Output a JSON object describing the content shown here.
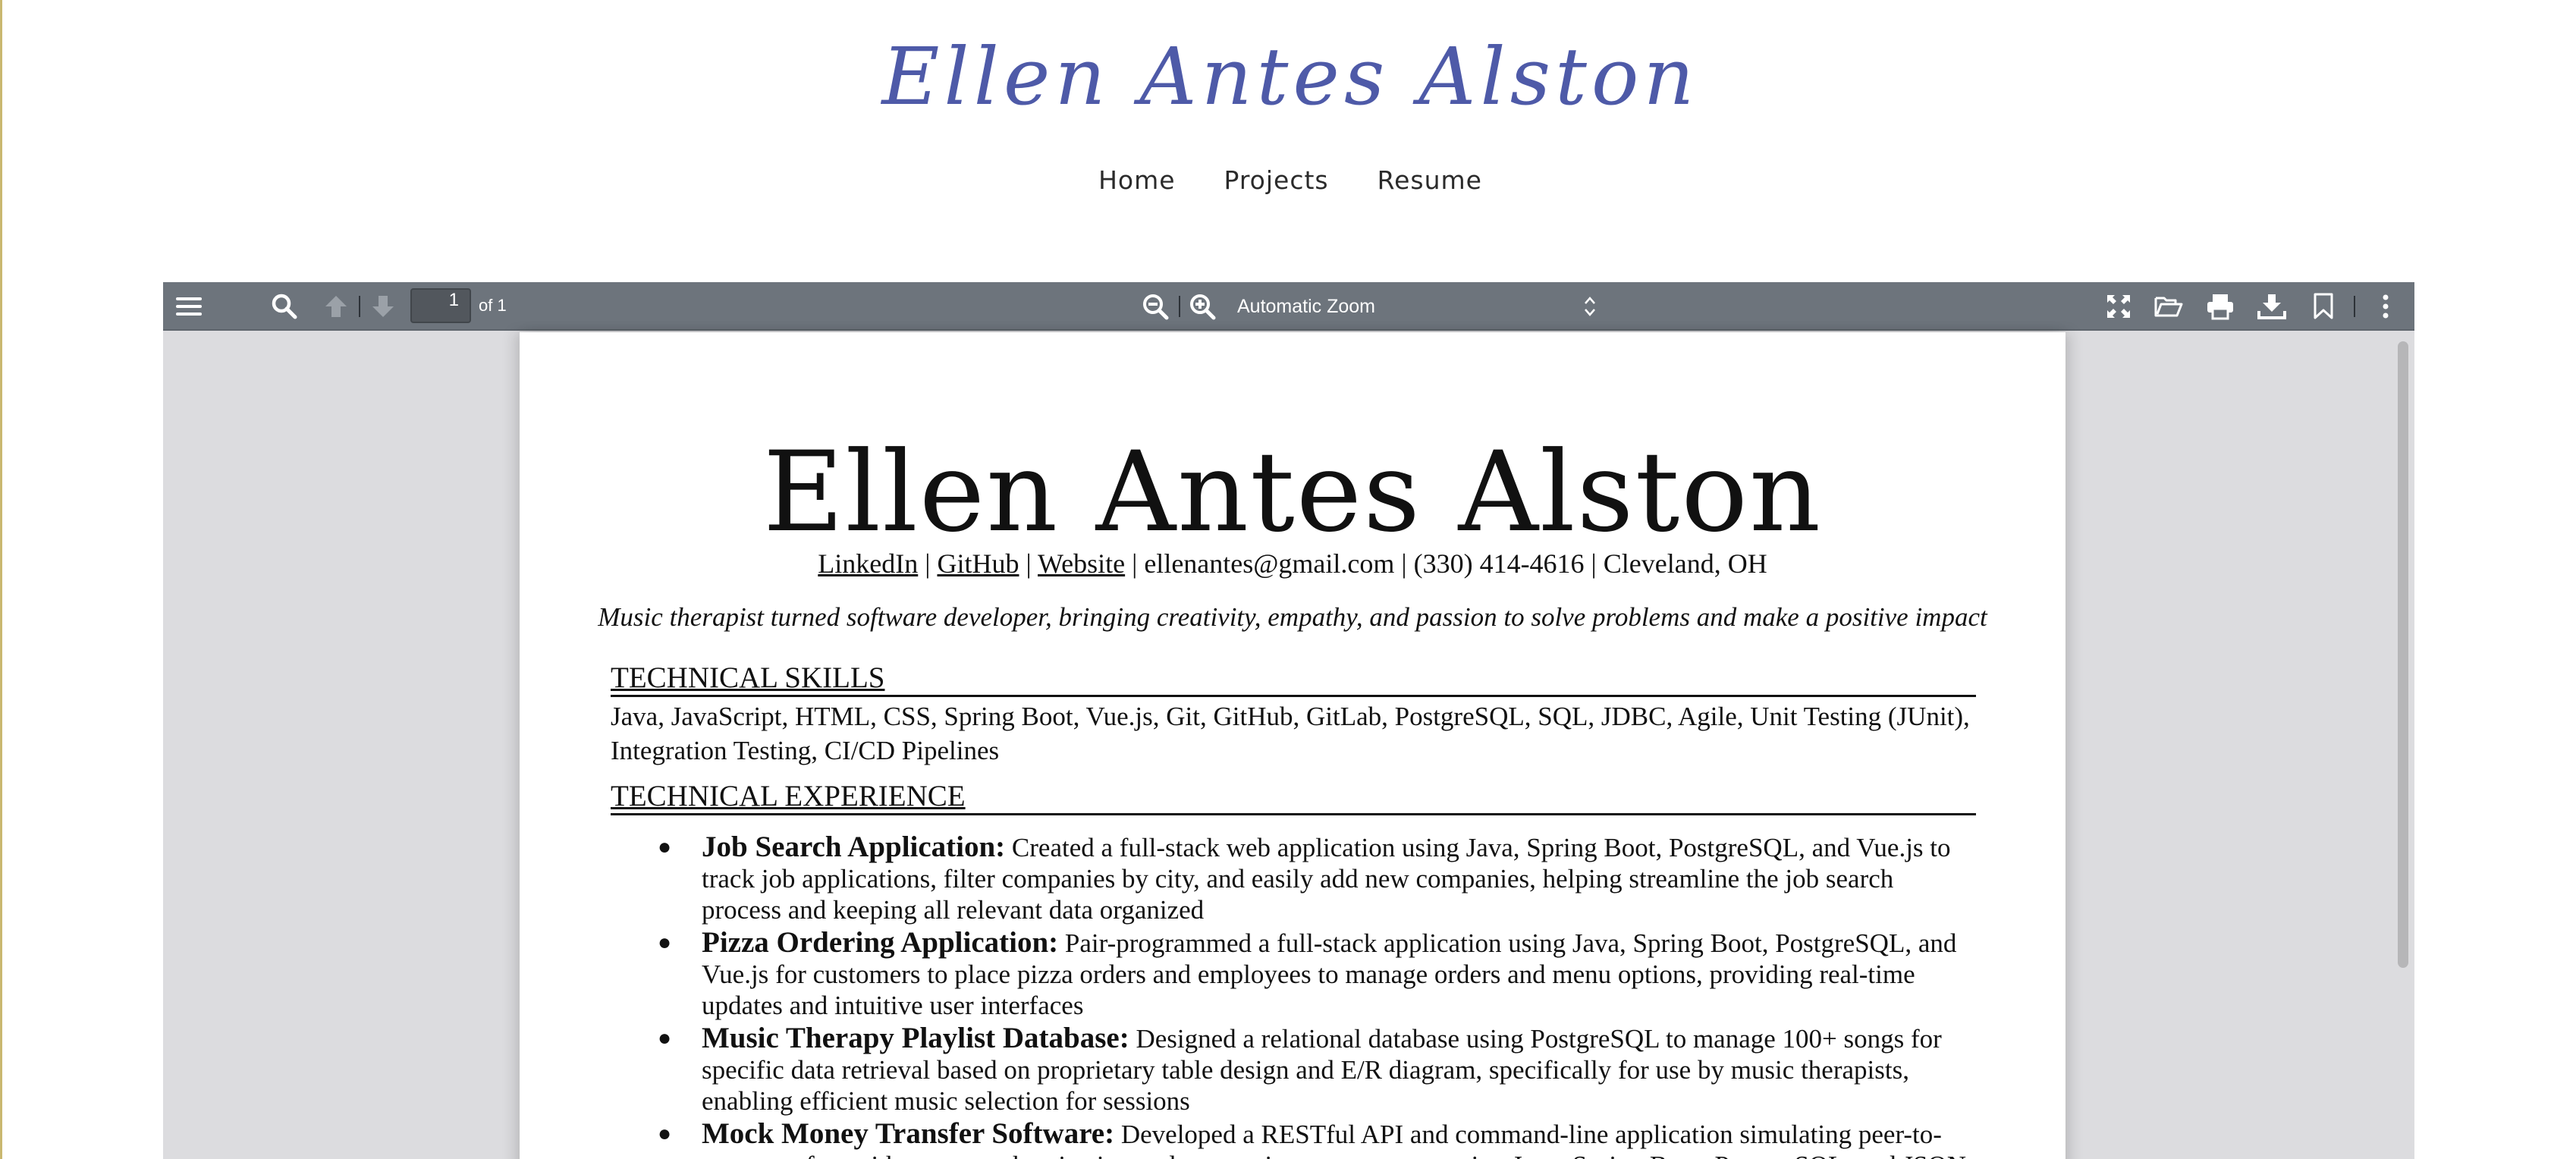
{
  "site": {
    "logo": "Ellen Antes Alston",
    "nav": [
      "Home",
      "Projects",
      "Resume"
    ]
  },
  "viewer": {
    "page_number": "1",
    "page_of": "of 1",
    "zoom": "Automatic Zoom",
    "icons": {
      "sidebar": "sidebar-toggle-icon",
      "find": "search-icon",
      "prev": "arrow-up-icon",
      "next": "arrow-down-icon",
      "zoom_out": "zoom-out-icon",
      "zoom_in": "zoom-in-icon",
      "presentation": "fullscreen-icon",
      "open": "open-folder-icon",
      "print": "print-icon",
      "download": "download-icon",
      "bookmark": "bookmark-icon",
      "tools": "more-vertical-icon"
    },
    "toolbar_color": "#6d747c"
  },
  "resume": {
    "name": "Ellen Antes Alston",
    "contact": {
      "linkedin": "LinkedIn",
      "github": "GitHub",
      "website": "Website",
      "rest": "| ellenantes@gmail.com  |  (330) 414-4616 | Cleveland, OH"
    },
    "tagline": "Music therapist turned software developer, bringing creativity, empathy, and passion to solve problems and make a positive impact",
    "skills_heading": "TECHNICAL SKILLS",
    "skills_line1": "Java, JavaScript, HTML, CSS, Spring Boot, Vue.js, Git, GitHub, GitLab, PostgreSQL, SQL, JDBC, Agile, Unit Testing (JUnit),",
    "skills_line2": "Integration Testing, CI/CD Pipelines",
    "experience_heading": "TECHNICAL EXPERIENCE",
    "experience": [
      {
        "title": "Job Search Application:",
        "lines": [
          "Created a full-stack web application using Java, Spring Boot, PostgreSQL, and Vue.js to track",
          "job applications, filter companies by city, and easily add new companies, helping streamline the job search process and",
          "keeping all relevant data organized"
        ]
      },
      {
        "title": "Pizza Ordering Application:",
        "lines": [
          "Pair-programmed  a full-stack application using Java, Spring Boot, PostgreSQL, and Vue.js",
          "for customers to place pizza orders and employees to manage orders and menu options, providing real-time updates and",
          "intuitive user interfaces"
        ]
      },
      {
        "title": "Music Therapy Playlist Database:",
        "lines": [
          "Designed a relational  database using PostgreSQL to manage 100+ songs for specific",
          "data retrieval based on proprietary table design and E/R diagram, specifically for use by music therapists, enabling efficient",
          "music selection for sessions"
        ]
      },
      {
        "title": "Mock Money Transfer Software:",
        "lines": [
          " Developed a RESTful API and command-line application simulating peer-to-peer",
          "transfers with secure authentication and transaction management using Java, Spring Boot, PostgreSQL, and JSON"
        ]
      }
    ]
  }
}
